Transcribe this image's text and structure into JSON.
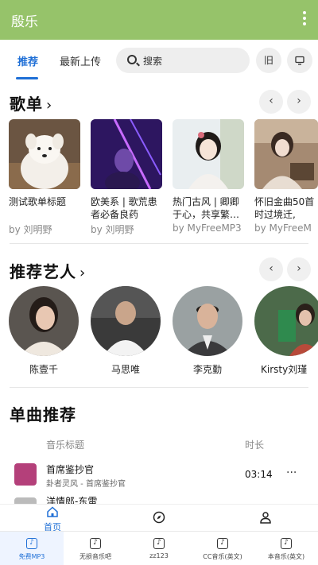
{
  "app": {
    "title": "殷乐"
  },
  "tabs": [
    {
      "label": "推荐",
      "active": true
    },
    {
      "label": "最新上传",
      "active": false
    }
  ],
  "search": {
    "placeholder": "搜索"
  },
  "toolbar": {
    "old_label": "旧"
  },
  "playlists": {
    "title": "歌单",
    "items": [
      {
        "name": "测试歌单标题",
        "by": "by 刘明野"
      },
      {
        "name": "欧美系 | 歌荒患者必备良药",
        "by": "by 刘明野"
      },
      {
        "name": "热门古风 | 卿卿于心，共享繁…",
        "by": "by MyFreeMP3"
      },
      {
        "name": "怀旧金曲50首 | 时过境迁,",
        "by": "by MyFreeM"
      }
    ]
  },
  "artists": {
    "title": "推荐艺人",
    "items": [
      {
        "name": "陈壹千"
      },
      {
        "name": "马思唯"
      },
      {
        "name": "李克勤"
      },
      {
        "name": "Kirsty刘瑾"
      }
    ]
  },
  "singles": {
    "title": "单曲推荐",
    "col_title": "音乐标题",
    "col_duration": "时长",
    "songs": [
      {
        "title": "首席鉴抄官",
        "subtitle": "卦者灵风 - 首席鉴抄官",
        "duration": "03:14",
        "more": "···"
      },
      {
        "title": "洋情郎-东雷"
      }
    ]
  },
  "nav": {
    "home_label": "首页"
  },
  "bottom_tabs": [
    {
      "label": "免费MP3",
      "active": true
    },
    {
      "label": "无损音乐吧",
      "active": false
    },
    {
      "label": "zz123",
      "active": false
    },
    {
      "label": "CC音乐(英文)",
      "active": false
    },
    {
      "label": "本音乐(英文)",
      "active": false
    }
  ],
  "colors": {
    "appbar": "#96c36a",
    "accent": "#1f6fd6"
  }
}
